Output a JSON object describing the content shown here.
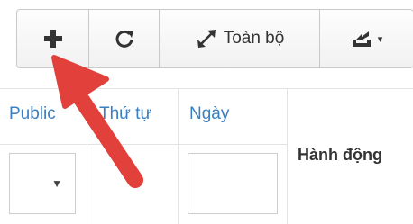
{
  "toolbar": {
    "add": {
      "icon": "plus-icon"
    },
    "refresh": {
      "icon": "refresh-icon"
    },
    "all": {
      "icon": "expand-icon",
      "label": "Toàn bộ"
    },
    "export": {
      "icon": "export-icon",
      "caret": "▾"
    }
  },
  "table": {
    "columns": [
      "Public",
      "Thứ tự",
      "Ngày"
    ],
    "action_header": "Hành động",
    "filters": {
      "public_select": {
        "value": "",
        "caret": "▼"
      },
      "date_input": {
        "value": ""
      }
    }
  },
  "annotation": {
    "color": "#e2403b"
  }
}
